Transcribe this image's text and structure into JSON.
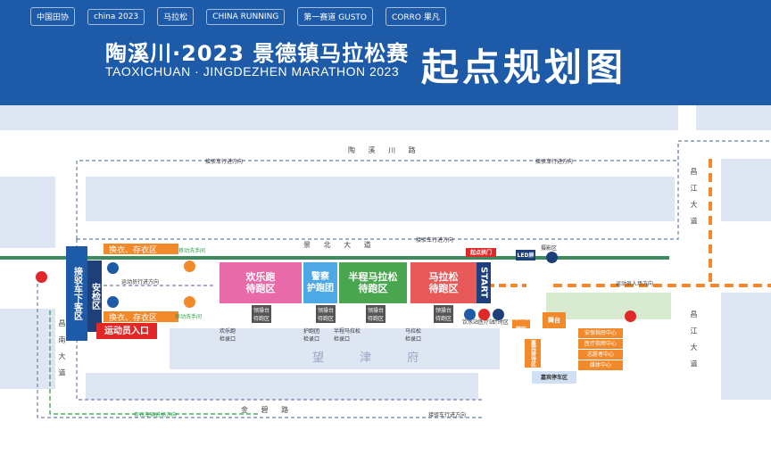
{
  "header": {
    "logos": [
      "中国田协",
      "china 2023",
      "马拉松",
      "CHINA RUNNING",
      "第一赛道 GUSTO",
      "CORRO 果凡"
    ],
    "title_cn": "陶溪川·2023 景德镇马拉松赛",
    "title_en": "TAOXICHUAN · JINGDEZHEN MARATHON 2023",
    "title_big": "起点规划图"
  },
  "map": {
    "roads": {
      "taoxichuan_road": "陶 溪 川 路",
      "jingbei_avenue": "景 北 大 道",
      "changjiang_avenue": "昌 江 大 道",
      "changnan_avenue": "昌 南 大 道",
      "jinbi_road": "金 碧 路",
      "wangjinfu": "望 津 府"
    },
    "directions": {
      "pickup_bus": "接驳车行进方向",
      "athlete": "运动员行进方向",
      "bag_car": "存衣车辆进场方向",
      "reverse": "运动员入场方向"
    },
    "zones": {
      "security": "安检区",
      "shuttle": "接驳车下客区",
      "entrance": "运动员入口",
      "fun_run": "欢乐跑\n待跑区",
      "police": "警察\n护跑团",
      "half": "半程马拉松\n待跑区",
      "marathon": "马拉松\n待跑区",
      "start": "START",
      "start_gate": "起点拱门",
      "led": "LED屏",
      "photo": "摄影区",
      "stage": "舞台",
      "change_top": "换衣、存衣区",
      "change_bottom": "换衣、存衣区",
      "toilet_top": "移动洗手间",
      "toilet_bottom": "移动洗手间",
      "water": "饮水站",
      "medical": "医疗站",
      "timing": "计时区",
      "reception": "嘉宾接待区",
      "guest_parking": "嘉宾停车区",
      "ops": "起点运营区"
    },
    "checkpoints": {
      "fun": "欢乐跑\n检录口",
      "police": "护跑团\n检录口",
      "half": "半程马拉松\n检录口",
      "marathon": "马拉松\n检录口"
    },
    "pickup_tags": [
      "领操台\n待跑区",
      "领操台\n待跑区",
      "领操台\n待跑区",
      "领操台\n待跑区"
    ],
    "services": [
      "安保指挥中心",
      "医疗指挥中心",
      "志愿者中心",
      "媒体中心"
    ]
  }
}
